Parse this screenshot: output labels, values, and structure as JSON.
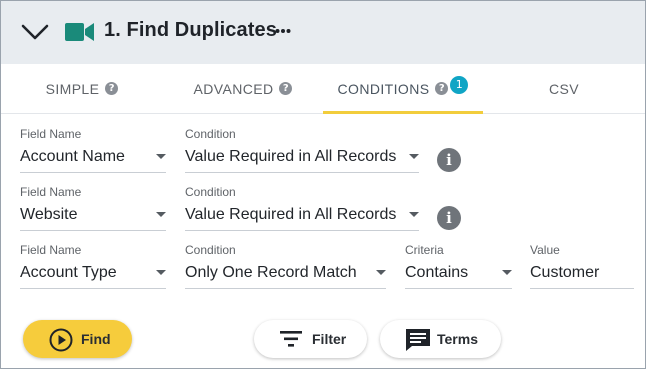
{
  "header": {
    "title": "1. Find Duplicates",
    "more_icon": "more-horizontal-icon",
    "collapse_icon": "chevron-down-icon",
    "video_icon": "video-camera-icon",
    "colors": {
      "background": "#e8ecf0",
      "camera": "#1a8a7a"
    }
  },
  "tabs": [
    {
      "label": "SIMPLE",
      "help": "?"
    },
    {
      "label": "ADVANCED",
      "help": "?"
    },
    {
      "label": "CONDITIONS",
      "help": "?",
      "badge": "1",
      "active": true
    },
    {
      "label": "CSV"
    }
  ],
  "labels": {
    "field_name": "Field Name",
    "condition": "Condition",
    "criteria": "Criteria",
    "value": "Value"
  },
  "rows": [
    {
      "field": "Account Name",
      "condition": "Value Required in All Records",
      "info": "i"
    },
    {
      "field": "Website",
      "condition": "Value Required in All Records",
      "info": "i"
    },
    {
      "field": "Account Type",
      "condition": "Only One Record Match",
      "criteria": "Contains",
      "value": "Customer"
    }
  ],
  "buttons": {
    "find": "Find",
    "filter": "Filter",
    "terms": "Terms"
  },
  "accent": {
    "tab_underline": "#f2cd3c",
    "badge": "#10a5c5",
    "find_button": "#f6cc3c"
  }
}
